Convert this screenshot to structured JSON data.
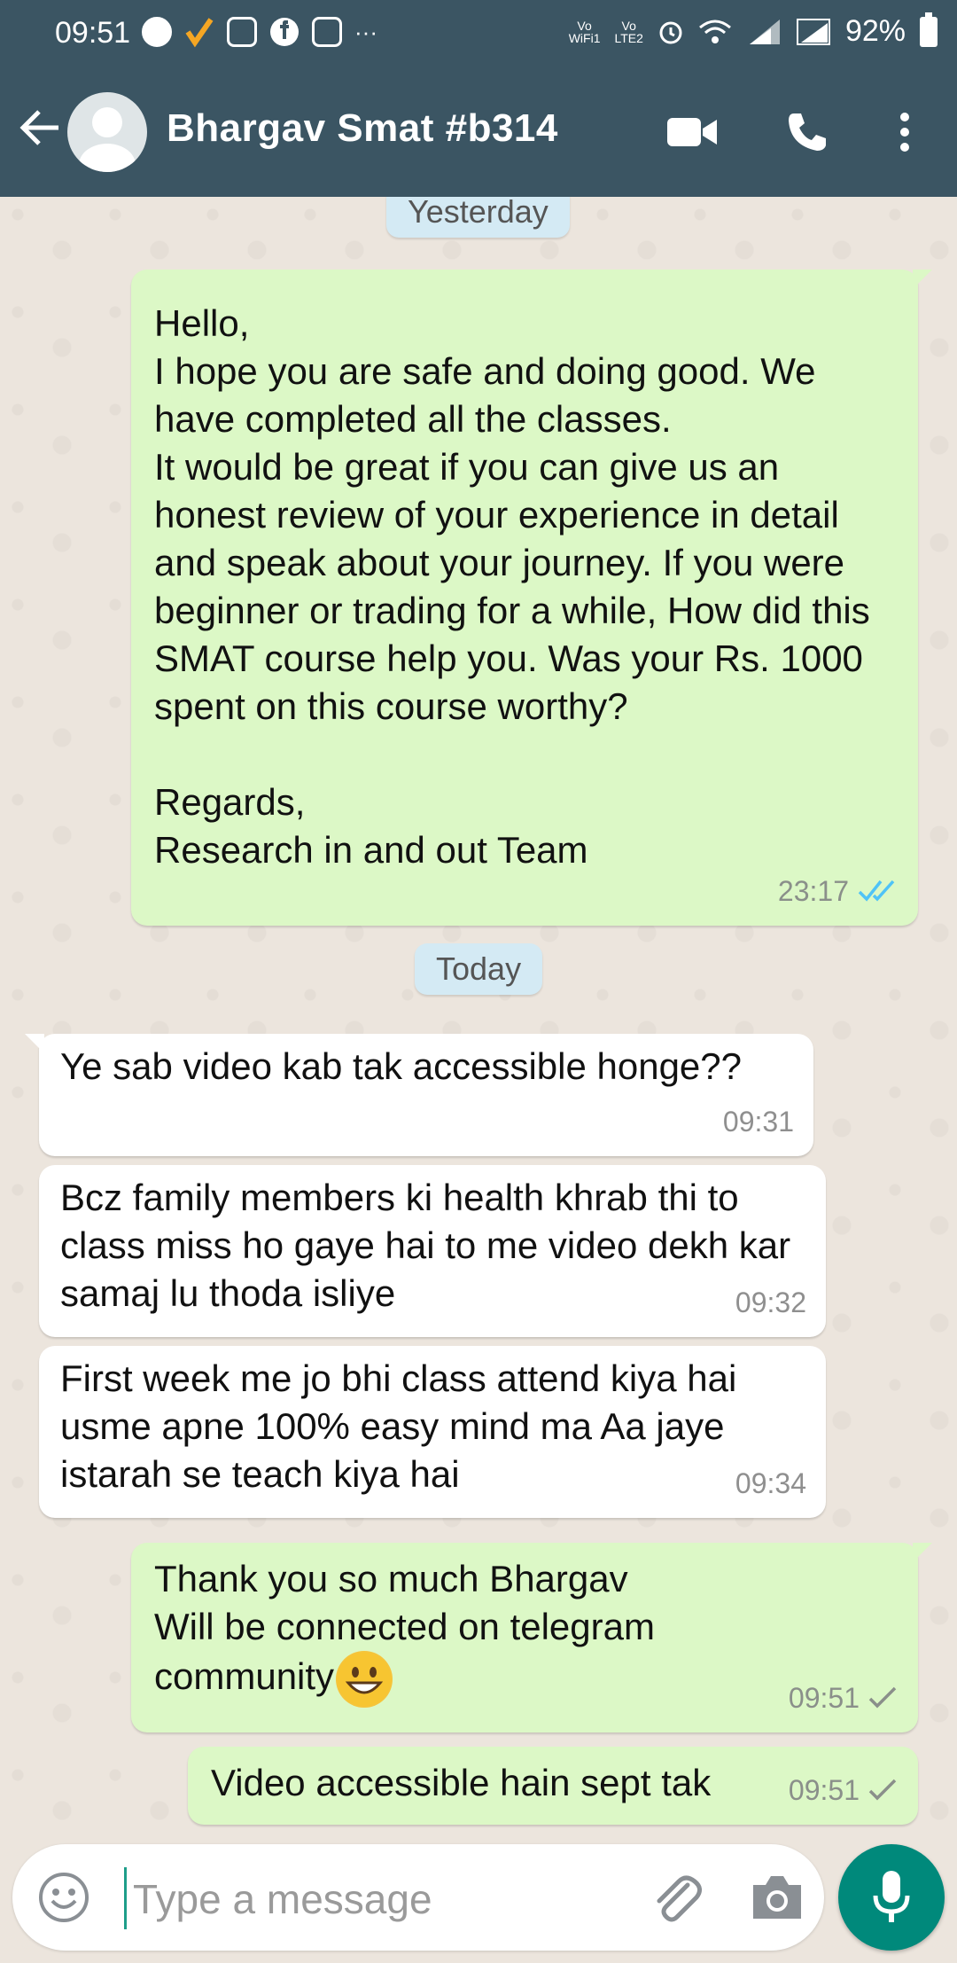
{
  "status_bar": {
    "time": "09:51",
    "vo_wifi": "Vo\nWiFi1",
    "vo_lte": "Vo\nLTE2",
    "battery": "92%"
  },
  "header": {
    "contact_name": "Bhargav Smat #b314"
  },
  "chat": {
    "day_labels": [
      "Yesterday",
      "Today"
    ],
    "messages": [
      {
        "direction": "outgoing",
        "text": "Hello,\nI hope you are safe and doing good. We have completed all the classes.\nIt would be great if you can give us an honest review of your experience in detail and speak about your journey. If you were beginner or trading for a while, How did this SMAT course help you. Was your Rs. 1000 spent on this course worthy?\n\nRegards,\nResearch in and out Team",
        "time": "23:17",
        "status": "read"
      },
      {
        "direction": "incoming",
        "text": "Ye sab video kab tak accessible honge??",
        "time": "09:31"
      },
      {
        "direction": "incoming",
        "text": "Bcz family members ki health khrab thi to class miss ho gaye hai to me video dekh kar samaj lu thoda isliye",
        "time": "09:32"
      },
      {
        "direction": "incoming",
        "text": "First week me jo bhi class attend kiya hai usme apne 100% easy mind ma Aa jaye istarah se teach kiya hai",
        "time": "09:34"
      },
      {
        "direction": "outgoing",
        "text": "Thank you so much Bhargav\nWill be connected on telegram community",
        "emoji": "grinning-face",
        "time": "09:51",
        "status": "sent"
      },
      {
        "direction": "outgoing",
        "text": "Video accessible hain sept tak",
        "time": "09:51",
        "status": "sent"
      }
    ]
  },
  "composer": {
    "placeholder": "Type a message"
  },
  "colors": {
    "header_bg": "#3b5563",
    "outgoing_bubble": "#dcf8c6",
    "incoming_bubble": "#ffffff",
    "chat_bg": "#ece5dd",
    "read_tick": "#4fc3f7",
    "mic_button": "#00897b"
  }
}
